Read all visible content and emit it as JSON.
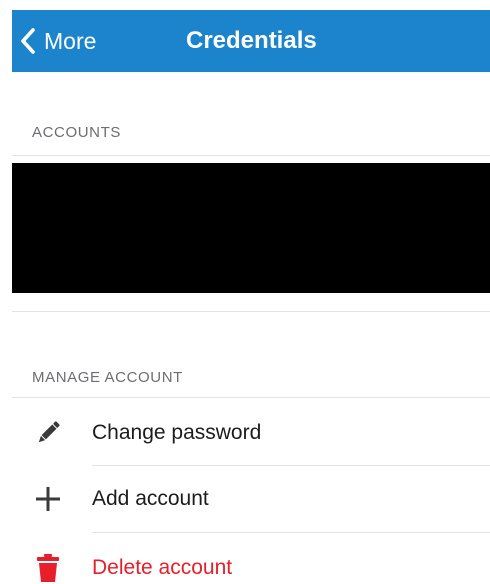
{
  "navbar": {
    "back_label": "More",
    "title": "Credentials",
    "color": "#1b84cc"
  },
  "accounts_section": {
    "header": "ACCOUNTS"
  },
  "manage_section": {
    "header": "MANAGE ACCOUNT",
    "items": [
      {
        "label": "Change password",
        "icon": "pencil-icon"
      },
      {
        "label": "Add account",
        "icon": "plus-icon"
      },
      {
        "label": "Delete account",
        "icon": "trash-icon",
        "color": "#e51f2b"
      }
    ]
  }
}
